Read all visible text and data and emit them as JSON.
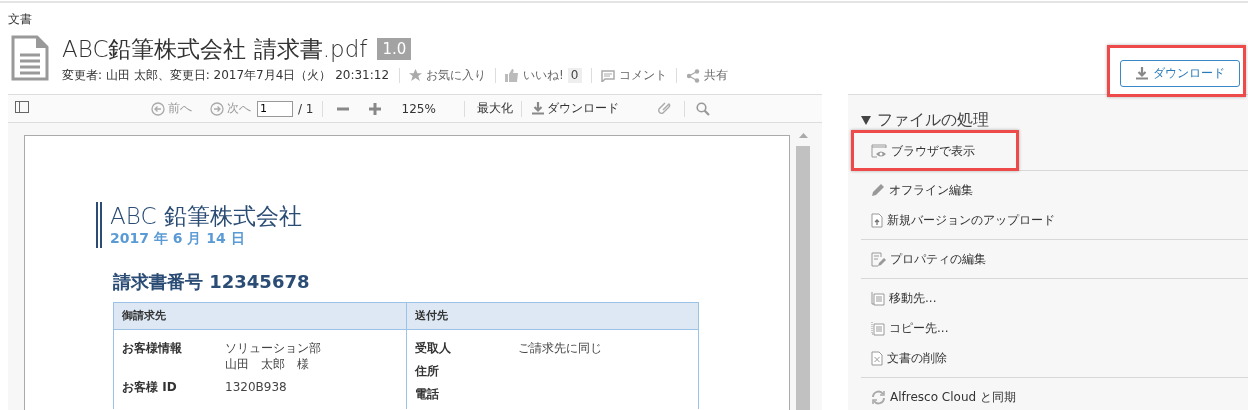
{
  "breadcrumb": "文書",
  "document": {
    "title": "ABC鉛筆株式会社 請求書.pdf",
    "version": "1.0",
    "meta": "変更者: 山田 太郎、変更日: 2017年7月4日（火） 20:31:12",
    "actions": [
      {
        "kind": "favorite",
        "label": "お気に入り"
      },
      {
        "kind": "like",
        "label": "いいね!",
        "count": "0"
      },
      {
        "kind": "comment",
        "label": "コメント"
      },
      {
        "kind": "share",
        "label": "共有"
      }
    ]
  },
  "download_button": {
    "label": "ダウンロード",
    "highlighted": true
  },
  "viewer": {
    "toolbar": {
      "prev": "前へ",
      "next": "次へ",
      "page": "1",
      "page_total": "/ 1",
      "zoom": "125%",
      "maximize": "最大化",
      "download": "ダウンロード"
    },
    "page": {
      "company": "ABC 鉛筆株式会社",
      "date": "2017 年 6 月 14 日",
      "invoice_no": "請求書番号 12345678",
      "sections": [
        {
          "heading": "御請求先",
          "rows": [
            {
              "label": "お客様情報",
              "lines": [
                "ソリューション部",
                "山田　太郎　様"
              ]
            },
            {
              "label": "お客様 ID",
              "lines": [
                "1320B938"
              ]
            }
          ]
        },
        {
          "heading": "送付先",
          "rows": [
            {
              "label": "受取人",
              "lines": [
                "ご請求先に同じ"
              ]
            },
            {
              "label": "住所"
            },
            {
              "label": "電話"
            }
          ]
        }
      ]
    }
  },
  "actions_panel": {
    "title": "ファイルの処理",
    "expanded": true,
    "groups": [
      {
        "items": [
          {
            "kind": "browser",
            "label": "ブラウザで表示",
            "highlighted": true
          }
        ]
      },
      {
        "items": [
          {
            "kind": "pencil",
            "label": "オフライン編集",
            "highlighted": false
          },
          {
            "kind": "upload",
            "label": "新規バージョンのアップロード",
            "highlighted": false
          }
        ]
      },
      {
        "items": [
          {
            "kind": "edit",
            "label": "プロパティの編集",
            "highlighted": false
          }
        ]
      },
      {
        "items": [
          {
            "kind": "move",
            "label": "移動先...",
            "highlighted": false
          },
          {
            "kind": "copy",
            "label": "コピー先...",
            "highlighted": false
          },
          {
            "kind": "delete",
            "label": "文書の削除",
            "highlighted": false
          }
        ]
      },
      {
        "items": [
          {
            "kind": "sync",
            "label": "Alfresco Cloud と同期",
            "highlighted": false
          }
        ]
      }
    ]
  }
}
